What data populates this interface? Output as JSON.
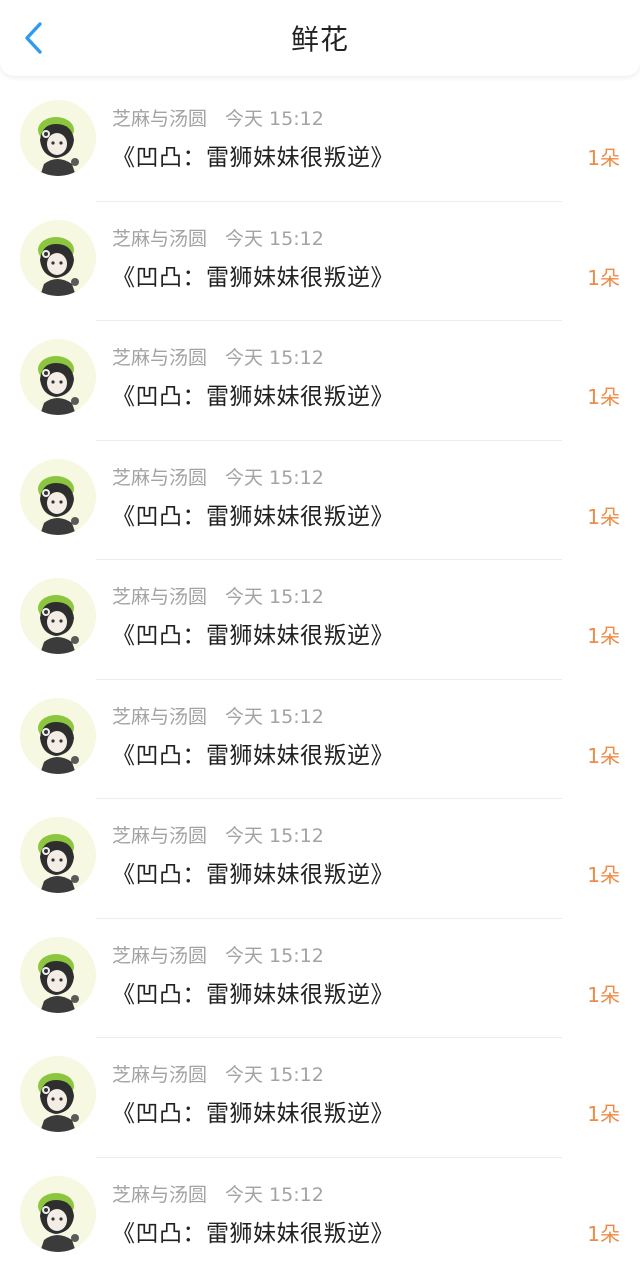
{
  "header": {
    "title": "鲜花"
  },
  "colors": {
    "accent_back": "#2f9bf0",
    "count": "#f08a45",
    "meta": "#a3a3a3"
  },
  "items": [
    {
      "user": "芝麻与汤圆",
      "time": "今天 15:12",
      "book": "《凹凸：雷狮妹妹很叛逆》",
      "count": "1朵"
    },
    {
      "user": "芝麻与汤圆",
      "time": "今天 15:12",
      "book": "《凹凸：雷狮妹妹很叛逆》",
      "count": "1朵"
    },
    {
      "user": "芝麻与汤圆",
      "time": "今天 15:12",
      "book": "《凹凸：雷狮妹妹很叛逆》",
      "count": "1朵"
    },
    {
      "user": "芝麻与汤圆",
      "time": "今天 15:12",
      "book": "《凹凸：雷狮妹妹很叛逆》",
      "count": "1朵"
    },
    {
      "user": "芝麻与汤圆",
      "time": "今天 15:12",
      "book": "《凹凸：雷狮妹妹很叛逆》",
      "count": "1朵"
    },
    {
      "user": "芝麻与汤圆",
      "time": "今天 15:12",
      "book": "《凹凸：雷狮妹妹很叛逆》",
      "count": "1朵"
    },
    {
      "user": "芝麻与汤圆",
      "time": "今天 15:12",
      "book": "《凹凸：雷狮妹妹很叛逆》",
      "count": "1朵"
    },
    {
      "user": "芝麻与汤圆",
      "time": "今天 15:12",
      "book": "《凹凸：雷狮妹妹很叛逆》",
      "count": "1朵"
    },
    {
      "user": "芝麻与汤圆",
      "time": "今天 15:12",
      "book": "《凹凸：雷狮妹妹很叛逆》",
      "count": "1朵"
    },
    {
      "user": "芝麻与汤圆",
      "time": "今天 15:12",
      "book": "《凹凸：雷狮妹妹很叛逆》",
      "count": "1朵"
    }
  ]
}
